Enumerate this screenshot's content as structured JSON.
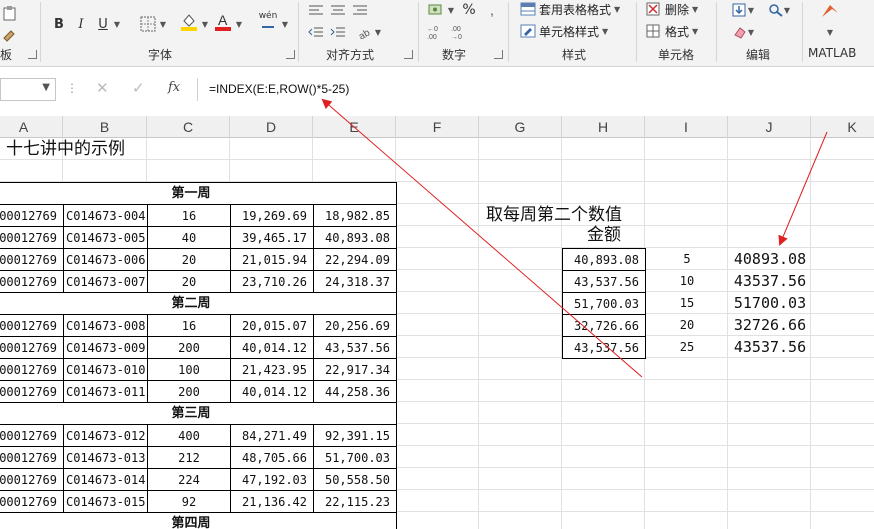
{
  "ribbon": {
    "font_buttons": [
      "B",
      "I",
      "U"
    ],
    "font_group_label": "字体",
    "font_size_grow_label": "wén",
    "align_group_label": "对齐方式",
    "number_group_label": "数字",
    "percent_symbol": "%",
    "styles": {
      "table_format": "套用表格格式",
      "cell_style": "单元格样式",
      "group_label": "样式"
    },
    "cells": {
      "delete": "删除",
      "format": "格式",
      "group_label": "单元格"
    },
    "edit_group_label": "编辑",
    "matlab_label": "MATLAB",
    "left_edge_label": "板"
  },
  "formula_bar": {
    "formula": "=INDEX(E:E,ROW()*5-25)",
    "fx": "fx"
  },
  "columns": [
    "A",
    "B",
    "C",
    "D",
    "E",
    "F",
    "G",
    "H",
    "I",
    "J",
    "K"
  ],
  "sheet": {
    "title": "十七讲中的示例",
    "weeks": [
      {
        "label": "第一周",
        "rows": [
          [
            "00012769",
            "C014673-004",
            "16",
            "19,269.69",
            "18,982.85"
          ],
          [
            "00012769",
            "C014673-005",
            "40",
            "39,465.17",
            "40,893.08"
          ],
          [
            "00012769",
            "C014673-006",
            "20",
            "21,015.94",
            "22,294.09"
          ],
          [
            "00012769",
            "C014673-007",
            "20",
            "23,710.26",
            "24,318.37"
          ]
        ]
      },
      {
        "label": "第二周",
        "rows": [
          [
            "00012769",
            "C014673-008",
            "16",
            "20,015.07",
            "20,256.69"
          ],
          [
            "00012769",
            "C014673-009",
            "200",
            "40,014.12",
            "43,537.56"
          ],
          [
            "00012769",
            "C014673-010",
            "100",
            "21,423.95",
            "22,917.34"
          ],
          [
            "00012769",
            "C014673-011",
            "200",
            "40,014.12",
            "44,258.36"
          ]
        ]
      },
      {
        "label": "第三周",
        "rows": [
          [
            "00012769",
            "C014673-012",
            "400",
            "84,271.49",
            "92,391.15"
          ],
          [
            "00012769",
            "C014673-013",
            "212",
            "48,705.66",
            "51,700.03"
          ],
          [
            "00012769",
            "C014673-014",
            "224",
            "47,192.03",
            "50,558.50"
          ],
          [
            "00012769",
            "C014673-015",
            "92",
            "21,136.42",
            "22,115.23"
          ]
        ]
      },
      {
        "label": "第四周",
        "rows": []
      }
    ],
    "side_title": "取每周第二个数值",
    "amount_header": "金额",
    "amounts": [
      "40,893.08",
      "43,537.56",
      "51,700.03",
      "32,726.66",
      "43,537.56"
    ],
    "indexes": [
      "5",
      "10",
      "15",
      "20",
      "25"
    ],
    "results": [
      "40893.08",
      "43537.56",
      "51700.03",
      "32726.66",
      "43537.56"
    ]
  },
  "colors": {
    "arrow": "#e02020",
    "font_highlight": "#ffd400",
    "font_color": "#e02020"
  }
}
